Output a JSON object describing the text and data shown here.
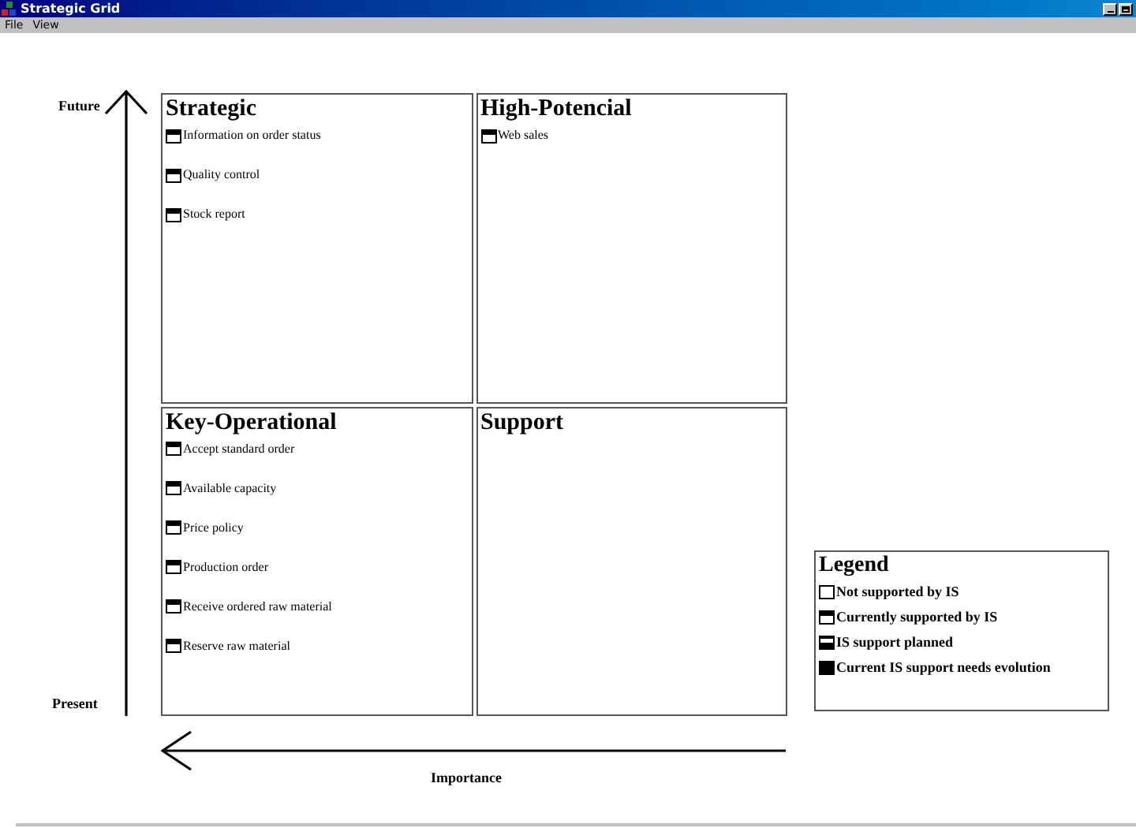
{
  "window": {
    "title": "Strategic Grid"
  },
  "menu": [
    "File",
    "View"
  ],
  "axes": {
    "y_top": "Future",
    "y_bottom": "Present",
    "x": "Importance"
  },
  "quadrants": [
    {
      "title": "Strategic",
      "items": [
        {
          "label": "Information on order status",
          "kind": "current"
        },
        {
          "label": "Quality control",
          "kind": "current"
        },
        {
          "label": "Stock report",
          "kind": "current"
        }
      ]
    },
    {
      "title": "High-Potencial",
      "items": [
        {
          "label": "Web sales",
          "kind": "current"
        }
      ]
    },
    {
      "title": "Key-Operational",
      "items": [
        {
          "label": "Accept standard order",
          "kind": "current"
        },
        {
          "label": "Available capacity",
          "kind": "current"
        },
        {
          "label": "Price policy",
          "kind": "current"
        },
        {
          "label": "Production order",
          "kind": "current"
        },
        {
          "label": "Receive ordered raw material",
          "kind": "current"
        },
        {
          "label": "Reserve raw material",
          "kind": "current"
        }
      ]
    },
    {
      "title": "Support"
    }
  ],
  "legend": {
    "title": "Legend",
    "items": [
      {
        "label": "Not supported by IS",
        "kind": "none"
      },
      {
        "label": "Currently supported by IS",
        "kind": "current"
      },
      {
        "label": "IS support planned",
        "kind": "planned"
      },
      {
        "label": "Current IS support needs evolution",
        "kind": "evolution"
      }
    ]
  }
}
